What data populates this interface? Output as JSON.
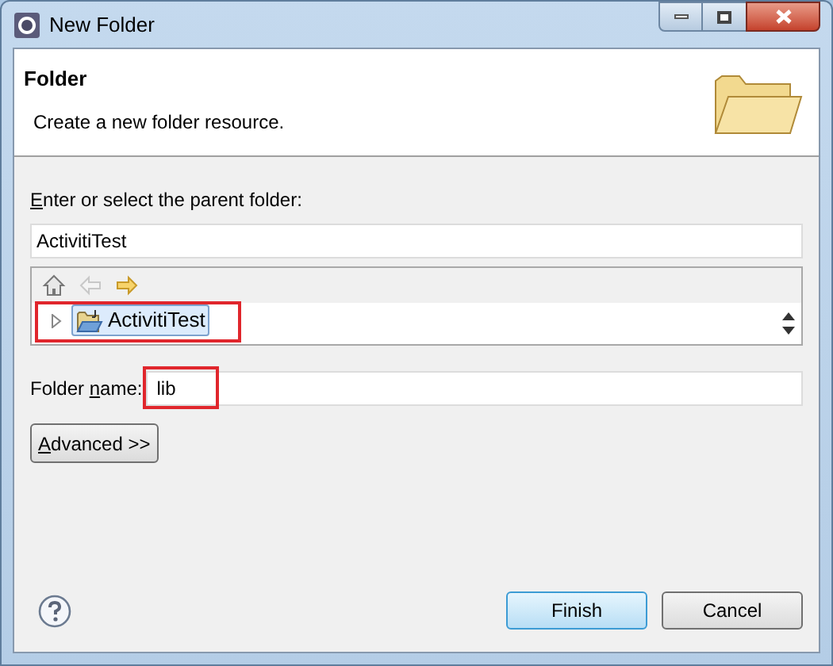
{
  "window": {
    "title": "New Folder"
  },
  "header": {
    "title": "Folder",
    "description": "Create a new folder resource."
  },
  "parent_folder": {
    "label": {
      "key": "E",
      "after": "nter or select the parent folder:"
    },
    "value": "ActivitiTest"
  },
  "navigation": [
    {
      "kind": "home",
      "disabled": false
    },
    {
      "kind": "back",
      "disabled": true
    },
    {
      "kind": "forward",
      "disabled": false
    }
  ],
  "tree": {
    "items": [
      {
        "label": "ActivitiTest",
        "selected": true,
        "expanded": false,
        "highlighted": true
      }
    ]
  },
  "folder_name": {
    "label": {
      "before": "Folder ",
      "key": "n",
      "after": "ame:"
    },
    "value": "lib",
    "highlighted": true
  },
  "advanced_button": {
    "key": "A",
    "after": "dvanced >>"
  },
  "buttons": [
    {
      "label": "Finish",
      "default": true
    },
    {
      "label": "Cancel",
      "default": false
    }
  ]
}
